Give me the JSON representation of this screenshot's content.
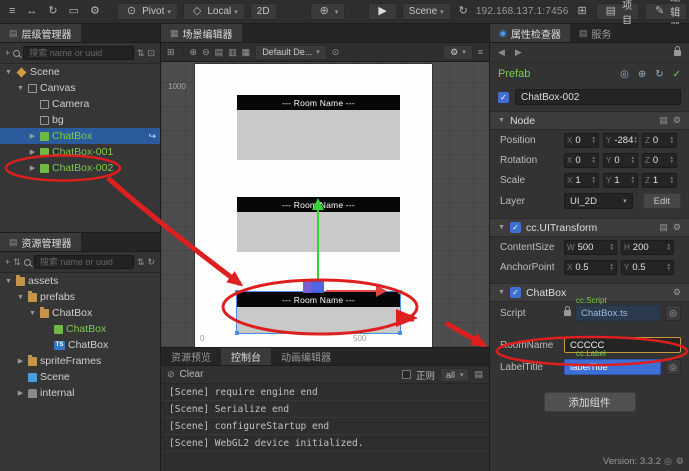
{
  "icons": {
    "menu": "≡",
    "move_tool": "↔",
    "rotate_tool": "↻",
    "rect_tool": "▭",
    "anchor_tool": "⊙",
    "pivot": "⊙",
    "local": "◇",
    "globe": "⊕",
    "play": "▶",
    "caret": "▾",
    "refresh": "↻",
    "grid": "⊞",
    "zoom_in": "⊕",
    "zoom_out": "⊖",
    "align_left": "▤",
    "align_center": "▥",
    "align_right": "▦",
    "gear": "⚙",
    "list": "≡",
    "plus": "+",
    "sort": "⇅",
    "expand_all": "⇅",
    "panel_toggle": "⊡",
    "back": "◀",
    "forward": "▶",
    "locate": "◎",
    "reset": "↻",
    "apply": "✓",
    "book": "▤",
    "target": "◎",
    "clear": "⊘",
    "doc": "▤",
    "edit_prefab": "↪",
    "ts_badge": "TS",
    "copy": "⊞",
    "project": "▤",
    "pencil": "✎",
    "tab_inspector": "◉",
    "tab_generic": "▤",
    "scene_tab": "▦"
  },
  "topbar": {
    "pivot": "Pivot",
    "local": "Local",
    "mode2d": "2D",
    "scene": "Scene",
    "ip": "192.168.137.1:7456",
    "project": "项目",
    "editor": "编辑器"
  },
  "hierarchy": {
    "tab": "层级管理器",
    "search_placeholder": "搜索 name or uuid",
    "items": [
      {
        "arrow": "▼",
        "label": "Scene"
      },
      {
        "arrow": "▼",
        "label": "Canvas"
      },
      {
        "arrow": "",
        "label": "Camera"
      },
      {
        "arrow": "",
        "label": "bg"
      },
      {
        "arrow": "▶",
        "label": "ChatBox"
      },
      {
        "arrow": "▶",
        "label": "ChatBox-001"
      },
      {
        "arrow": "▶",
        "label": "ChatBox-002"
      }
    ]
  },
  "assets": {
    "tab": "资源管理器",
    "search_placeholder": "搜索 name or uuid",
    "items": [
      {
        "arrow": "▼",
        "label": "assets"
      },
      {
        "arrow": "▼",
        "label": "prefabs"
      },
      {
        "arrow": "▼",
        "label": "ChatBox"
      },
      {
        "arrow": "",
        "label": "ChatBox"
      },
      {
        "arrow": "",
        "label": "ChatBox"
      },
      {
        "arrow": "▶",
        "label": "spriteFrames"
      },
      {
        "arrow": "",
        "label": "Scene"
      },
      {
        "arrow": "▶",
        "label": "internal"
      }
    ]
  },
  "scene": {
    "tab": "场景编辑器",
    "dropdown": "Default De...",
    "box_title": "--- Room Name ---",
    "ruler": {
      "r1000": "1000",
      "r0": "0",
      "r500": "500"
    }
  },
  "console": {
    "tab_preview": "资源预览",
    "tab_console": "控制台",
    "tab_anim": "动画编辑器",
    "clear": "Clear",
    "regex": "正则",
    "filter": "all",
    "logs": [
      "[Scene] require engine end",
      "[Scene] Serialize end",
      "[Scene] configureStartup end",
      "[Scene] WebGL2 device initialized."
    ]
  },
  "inspector": {
    "tab_inspector": "属性检查器",
    "tab_service": "服务",
    "prefab": "Prefab",
    "name": "ChatBox-002",
    "axis": {
      "x": "X",
      "y": "Y",
      "z": "Z",
      "w": "W",
      "h": "H"
    },
    "node": {
      "title": "Node",
      "position_label": "Position",
      "rotation_label": "Rotation",
      "scale_label": "Scale",
      "layer_label": "Layer",
      "layer": "UI_2D",
      "edit": "Edit",
      "position": {
        "x": "0",
        "y": "-284",
        "z": "0"
      },
      "rotation": {
        "x": "0",
        "y": "0",
        "z": "0"
      },
      "scale": {
        "x": "1",
        "y": "1",
        "z": "1"
      }
    },
    "uitransform": {
      "title": "cc.UITransform",
      "contentsize_label": "ContentSize",
      "anchorpoint_label": "AnchorPoint",
      "size": {
        "w": "500",
        "h": "200"
      },
      "anchor": {
        "x": "0.5",
        "y": "0.5"
      }
    },
    "chatbox": {
      "title": "ChatBox",
      "script_label": "Script",
      "script": "ChatBox.ts",
      "script_hint": "cc.Script",
      "roomname_label": "RoomName",
      "roomname": "CCCCC",
      "label_hint": "cc.Label",
      "labeltitle_label": "LabelTitle",
      "labeltitle": "labelTitle"
    },
    "add_component": "添加组件"
  },
  "status": {
    "version": "Version: 3.3.2"
  }
}
